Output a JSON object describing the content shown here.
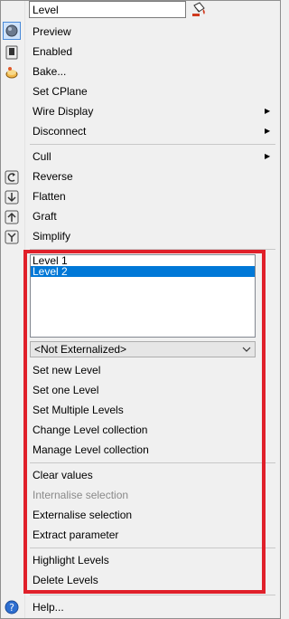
{
  "name_field": {
    "value": "Level"
  },
  "menu": {
    "preview": "Preview",
    "enabled": "Enabled",
    "bake": "Bake...",
    "set_cplane": "Set CPlane",
    "wire_display": "Wire Display",
    "disconnect": "Disconnect",
    "cull": "Cull",
    "reverse": "Reverse",
    "flatten": "Flatten",
    "graft": "Graft",
    "simplify": "Simplify"
  },
  "levels_list": {
    "items": [
      "Level 1",
      "Level 2"
    ],
    "selected": "Level 2"
  },
  "externalize_dropdown": {
    "value": "<Not Externalized>"
  },
  "level_actions": {
    "set_new_level": "Set new Level",
    "set_one_level": "Set one Level",
    "set_multiple_levels": "Set Multiple Levels",
    "change_level_collection": "Change Level collection",
    "manage_level_collection": "Manage Level collection",
    "clear_values": "Clear values",
    "internalise_selection": "Internalise selection",
    "externalise_selection": "Externalise selection",
    "extract_parameter": "Extract parameter",
    "highlight_levels": "Highlight Levels",
    "delete_levels": "Delete Levels"
  },
  "help": "Help...",
  "colors": {
    "selection_blue": "#0078d7",
    "highlight_frame_red": "#e0202a",
    "disabled_text": "#8a8a8a"
  }
}
